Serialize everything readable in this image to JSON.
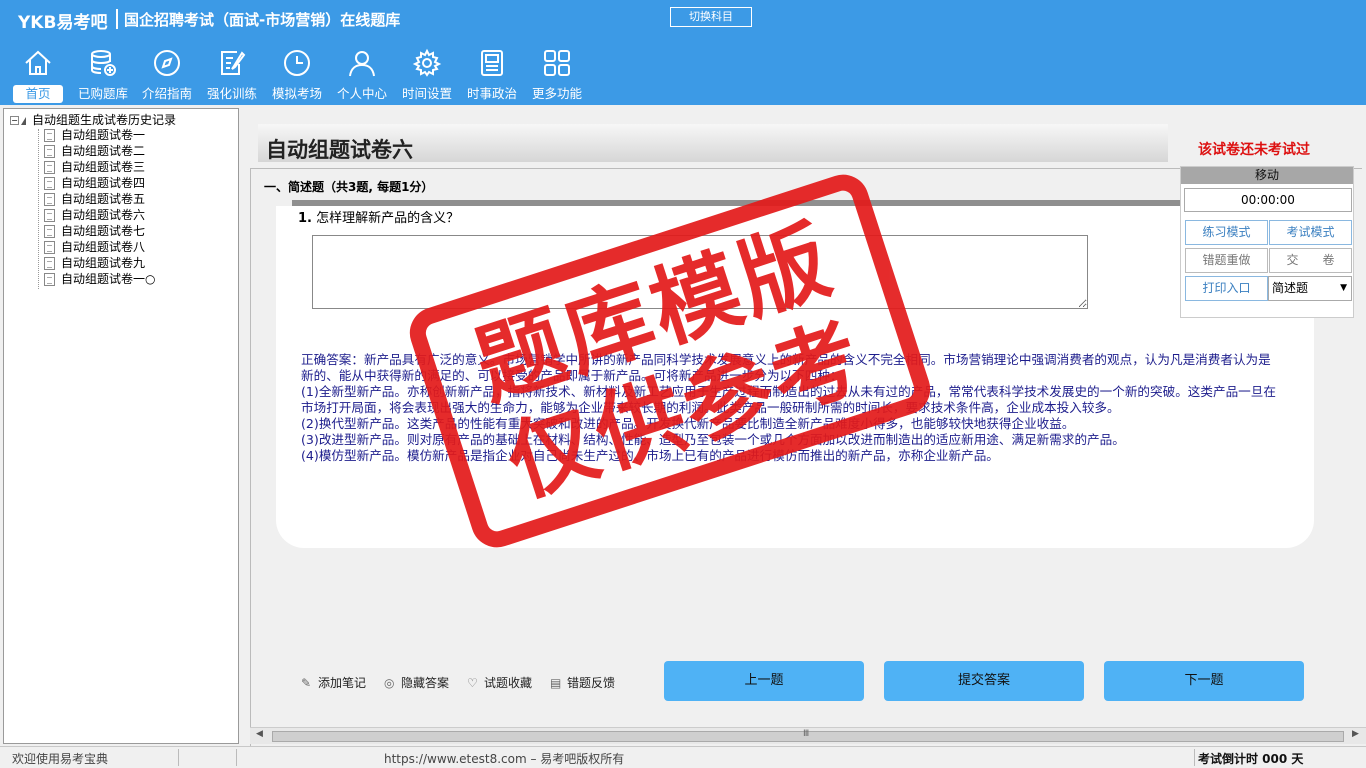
{
  "header": {
    "logo": "YKB易考吧",
    "title": "国企招聘考试（面试-市场营销）在线题库",
    "switch_subject": "切换科目"
  },
  "nav": [
    {
      "label": "首页",
      "icon": "home-icon"
    },
    {
      "label": "已购题库",
      "icon": "database-icon"
    },
    {
      "label": "介绍指南",
      "icon": "compass-icon"
    },
    {
      "label": "强化训练",
      "icon": "edit-icon"
    },
    {
      "label": "模拟考场",
      "icon": "clock-icon"
    },
    {
      "label": "个人中心",
      "icon": "user-icon"
    },
    {
      "label": "时间设置",
      "icon": "gear-icon"
    },
    {
      "label": "时事政治",
      "icon": "news-icon"
    },
    {
      "label": "更多功能",
      "icon": "grid-icon"
    }
  ],
  "tree": {
    "root": "自动组题生成试卷历史记录",
    "items": [
      "自动组题试卷一",
      "自动组题试卷二",
      "自动组题试卷三",
      "自动组题试卷四",
      "自动组题试卷五",
      "自动组题试卷六",
      "自动组题试卷七",
      "自动组题试卷八",
      "自动组题试卷九",
      "自动组题试卷一○"
    ]
  },
  "paper": {
    "title": "自动组题试卷六",
    "status": "该试卷还未考试过",
    "section": "一、简述题（共3题, 每题1分）",
    "question_no": "1.",
    "question": "怎样理解新产品的含义？",
    "answer_lines": [
      "正确答案：新产品具有广泛的意义。市场营销学中所讲的新产品同科学技术发展意义上的新产品的含义不完全相同。市场营销理论中强调消费者的观点，认为凡是消费者认为是新的、能从中获得新的满足的、可以接受的产品即属于新产品。可将新产品进一步分为以下四种：",
      "(1)全新型新产品。亦称创新新产品，指将新技术、新材料及新工艺应用于生产过程而制造出的过去从未有过的产品，常常代表科学技术发展史的一个新的突破。这类产品一旦在市场打开局面，将会表现出强大的生命力，能够为企业带来较长期的利润。此类产品一般研制所需的时间长，要求技术条件高，企业成本投入较多。",
      "(2)换代型新产品。这类产品的性能有重大突破和改进的产品。开发换代新产品要比制造全新产品难度小得多，也能够较快地获得企业收益。",
      "(3)改进型新产品。则对原有产品的基础上在材料、结构、性能、造型乃至包装一个或几个方面加以改进而制造出的适应新用途、满足新需求的产品。",
      "(4)模仿型新产品。模仿新产品是指企业对自己尚未生产过的、市场上已有的产品进行模仿而推出的新产品，亦称企业新产品。"
    ]
  },
  "tools": [
    {
      "label": "添加笔记",
      "icon": "pencil-icon"
    },
    {
      "label": "隐藏答案",
      "icon": "eye-icon"
    },
    {
      "label": "试题收藏",
      "icon": "heart-icon"
    },
    {
      "label": "错题反馈",
      "icon": "feedback-icon"
    }
  ],
  "buttons": {
    "prev": "上一题",
    "submit": "提交答案",
    "next": "下一题"
  },
  "widget": {
    "title": "移动",
    "timer": "00:00:00",
    "practice": "练习模式",
    "exam": "考试模式",
    "redo": "错题重做",
    "hand_in": "交　　卷",
    "print": "打印入口",
    "type_select": "简述题"
  },
  "scrollbar": {
    "grip": "Ⅲ"
  },
  "status": {
    "welcome": "欢迎使用易考宝典",
    "site": "https://www.etest8.com – 易考吧版权所有",
    "countdown": "考试倒计时 000 天"
  },
  "watermark": {
    "line1": "题库模版",
    "line2": "仅供参考"
  }
}
